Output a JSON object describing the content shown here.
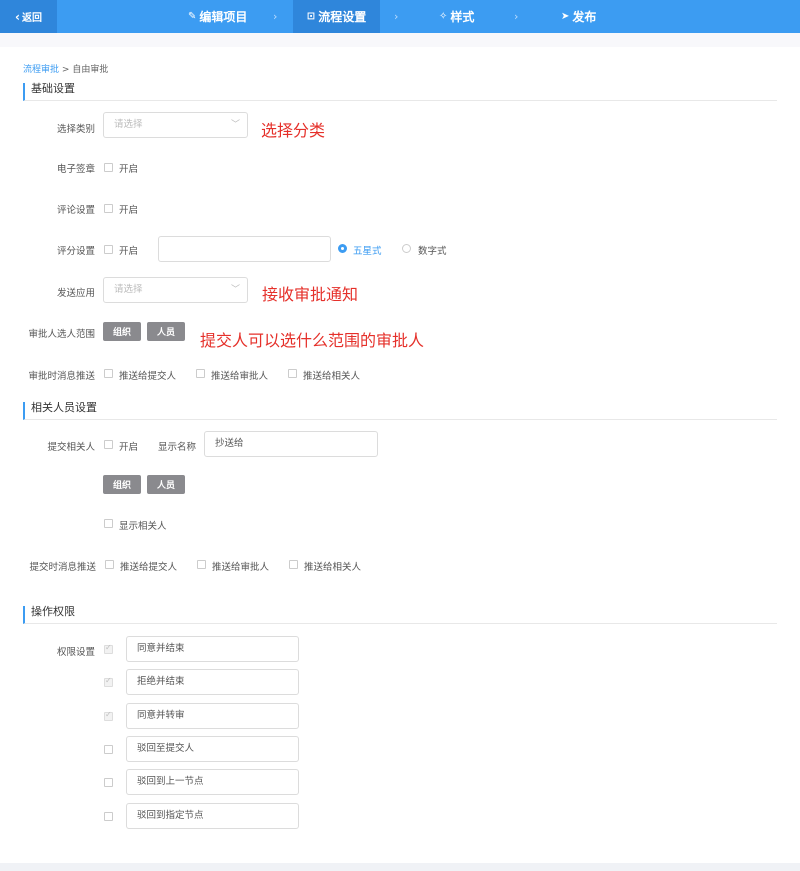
{
  "topbar": {
    "back_label": "返回",
    "steps": [
      {
        "icon": "pencil-icon",
        "label": "编辑项目"
      },
      {
        "icon": "flow-icon",
        "label": "流程设置"
      },
      {
        "icon": "style-icon",
        "label": "样式"
      },
      {
        "icon": "send-icon",
        "label": "发布"
      }
    ],
    "active_step": "流程设置",
    "accent": "#3c9cf2"
  },
  "breadcrumb": {
    "parent": "流程审批",
    "separator": ">",
    "current": "自由审批"
  },
  "basic": {
    "title": "基础设置",
    "category": {
      "label": "选择类别",
      "placeholder": "请选择",
      "note": "选择分类"
    },
    "signature": {
      "label": "电子签章",
      "option": "开启"
    },
    "comment": {
      "label": "评论设置",
      "option": "开启"
    },
    "score": {
      "label": "评分设置",
      "option": "开启",
      "input_value": "",
      "radio1": "五星式",
      "radio2": "数字式",
      "selected": "五星式"
    },
    "app": {
      "label": "发送应用",
      "placeholder": "请选择",
      "note": "接收审批通知"
    },
    "range": {
      "label": "审批人选人范围",
      "btn_org": "组织",
      "btn_person": "人员",
      "note": "提交人可以选什么范围的审批人"
    },
    "push": {
      "label": "审批时消息推送",
      "opt1": "推送给提交人",
      "opt2": "推送给审批人",
      "opt3": "推送给相关人"
    }
  },
  "related": {
    "title": "相关人员设置",
    "submit": {
      "label": "提交相关人",
      "option": "开启",
      "name_label": "显示名称",
      "name_value": "抄送给"
    },
    "btn_org": "组织",
    "btn_person": "人员",
    "show": "显示相关人",
    "push": {
      "label": "提交时消息推送",
      "opt1": "推送给提交人",
      "opt2": "推送给审批人",
      "opt3": "推送给相关人"
    }
  },
  "perm": {
    "title": "操作权限",
    "label": "权限设置",
    "items": [
      {
        "text": "同意并结束",
        "checked": true
      },
      {
        "text": "拒绝并结束",
        "checked": true
      },
      {
        "text": "同意并转审",
        "checked": true
      },
      {
        "text": "驳回至提交人",
        "checked": false
      },
      {
        "text": "驳回到上一节点",
        "checked": false
      },
      {
        "text": "驳回到指定节点",
        "checked": false
      }
    ]
  }
}
